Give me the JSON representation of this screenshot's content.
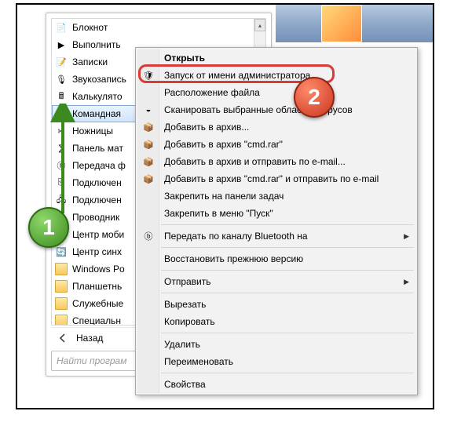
{
  "start_menu": {
    "items": [
      {
        "label": "Блокнот",
        "icon": "📄"
      },
      {
        "label": "Выполнить",
        "icon": "▶"
      },
      {
        "label": "Записки",
        "icon": "📝"
      },
      {
        "label": "Звукозапись",
        "icon": "🎙"
      },
      {
        "label": "Калькулято",
        "icon": "🖩"
      },
      {
        "label": "Командная",
        "icon": "▣",
        "selected": true
      },
      {
        "label": "Ножницы",
        "icon": "✂"
      },
      {
        "label": "Панель мат",
        "icon": "∑"
      },
      {
        "label": "Передача ф",
        "icon": "ⓑ"
      },
      {
        "label": "Подключен",
        "icon": "⎘"
      },
      {
        "label": "Подключен",
        "icon": "🖧"
      },
      {
        "label": "Проводник",
        "icon": "📂"
      },
      {
        "label": "Центр моби",
        "icon": "💻"
      },
      {
        "label": "Центр синх",
        "icon": "🔄"
      },
      {
        "label": "Windows Po",
        "icon": "",
        "folder": true
      },
      {
        "label": "Планшетнь",
        "icon": "",
        "folder": true
      },
      {
        "label": "Служебные",
        "icon": "",
        "folder": true
      },
      {
        "label": "Специальн",
        "icon": "",
        "folder": true
      }
    ],
    "back_label": "Назад",
    "search_placeholder": "Найти програм"
  },
  "context_menu": {
    "items": [
      {
        "label": "Открыть",
        "bold": true
      },
      {
        "label": "Запуск от имени администратора",
        "icon": "🛡",
        "highlight": true
      },
      {
        "label": "Расположение файла"
      },
      {
        "label": "Сканировать выбранные облас              ие вирусов",
        "icon": "◒"
      },
      {
        "label": "Добавить в архив...",
        "icon": "📦"
      },
      {
        "label": "Добавить в архив \"cmd.rar\"",
        "icon": "📦"
      },
      {
        "label": "Добавить в архив и отправить по e-mail...",
        "icon": "📦"
      },
      {
        "label": "Добавить в архив \"cmd.rar\" и отправить по e-mail",
        "icon": "📦"
      },
      {
        "label": "Закрепить на панели задач"
      },
      {
        "label": "Закрепить в меню \"Пуск\""
      },
      {
        "sep": true
      },
      {
        "label": "Передать по каналу Bluetooth на",
        "icon": "ⓑ",
        "submenu": true
      },
      {
        "sep": true
      },
      {
        "label": "Восстановить прежнюю версию"
      },
      {
        "sep": true
      },
      {
        "label": "Отправить",
        "submenu": true
      },
      {
        "sep": true
      },
      {
        "label": "Вырезать"
      },
      {
        "label": "Копировать"
      },
      {
        "sep": true
      },
      {
        "label": "Удалить"
      },
      {
        "label": "Переименовать"
      },
      {
        "sep": true
      },
      {
        "label": "Свойства"
      }
    ]
  },
  "badges": {
    "one": "1",
    "two": "2"
  }
}
